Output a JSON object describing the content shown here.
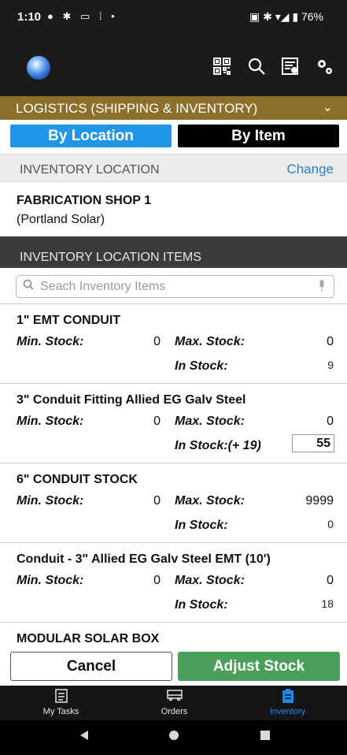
{
  "status_bar": {
    "time": "1:10",
    "left_icons": "● ✱ ▭ ⁞ •",
    "battery": "76%",
    "right_icons": "▣ ✱ ▾◢ ▮"
  },
  "header": {
    "icons": [
      "qr-code-icon",
      "search-icon",
      "report-icon",
      "settings-icon"
    ]
  },
  "section": {
    "title": "LOGISTICS  (SHIPPING & INVENTORY)",
    "chevron": "⌄"
  },
  "toggle": {
    "by_location": "By Location",
    "by_item": "By Item"
  },
  "location": {
    "header": "INVENTORY LOCATION",
    "change": "Change",
    "name": "FABRICATION SHOP 1",
    "company": "(Portland Solar)"
  },
  "items_section": {
    "header": "INVENTORY LOCATION ITEMS",
    "search_placeholder": "Seach Inventory Items"
  },
  "items": [
    {
      "name": "1\" EMT CONDUIT",
      "min_label": "Min. Stock:",
      "min_value": "0",
      "max_label": "Max. Stock:",
      "max_value": "0",
      "instock_label": "In Stock:",
      "instock_value": "9"
    },
    {
      "name": "3\" Conduit Fitting Allied EG Galv Steel",
      "min_label": "Min. Stock:",
      "min_value": "0",
      "max_label": "Max. Stock:",
      "max_value": "0",
      "instock_label": "In Stock:(+ 19)",
      "instock_value": "55"
    },
    {
      "name": "6\" CONDUIT STOCK",
      "min_label": "Min. Stock:",
      "min_value": "0",
      "max_label": "Max. Stock:",
      "max_value": "9999",
      "instock_label": "In Stock:",
      "instock_value": "0"
    },
    {
      "name": "Conduit - 3\" Allied EG Galv Steel EMT (10')",
      "min_label": "Min. Stock:",
      "min_value": "0",
      "max_label": "Max. Stock:",
      "max_value": "0",
      "instock_label": "In Stock:",
      "instock_value": "18"
    },
    {
      "name": "MODULAR SOLAR BOX"
    }
  ],
  "actions": {
    "cancel": "Cancel",
    "adjust": "Adjust Stock"
  },
  "tabs": [
    {
      "label": "My Tasks",
      "icon": "clipboard-icon",
      "active": false
    },
    {
      "label": "Orders",
      "icon": "truck-icon",
      "active": false
    },
    {
      "label": "Inventory",
      "icon": "inventory-icon",
      "active": true
    }
  ],
  "colors": {
    "section_header": "#8b6f2a",
    "by_location": "#2196e8",
    "adjust_button": "#4a9f5a",
    "active_tab": "#1e88e5"
  }
}
